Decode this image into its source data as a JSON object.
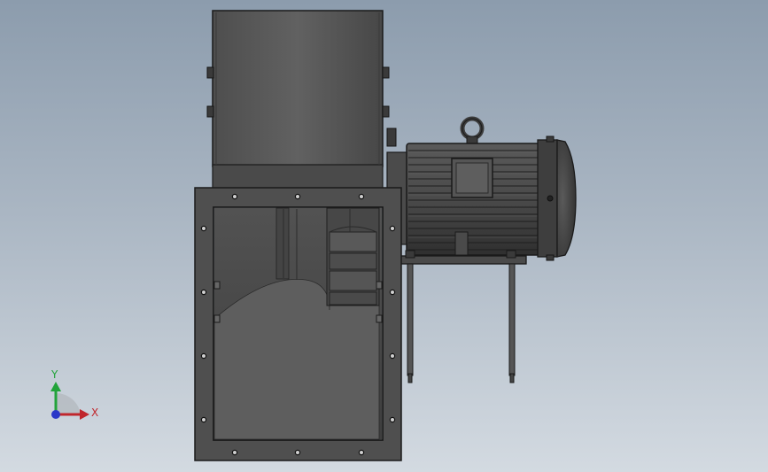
{
  "viewport": {
    "background_top": "#8c9cad",
    "background_bottom": "#d3dae1"
  },
  "model": {
    "body_color": "#4b4b4b",
    "edge_color": "#1a1a1a",
    "parts": [
      "fan-housing",
      "inlet-flange",
      "motor",
      "eye-bolt",
      "terminal-box",
      "motor-base",
      "support-legs"
    ]
  },
  "triad": {
    "x_label": "X",
    "y_label": "Y",
    "x_color": "#c0262c",
    "y_color": "#22a33a",
    "z_color": "#2b38c8"
  }
}
